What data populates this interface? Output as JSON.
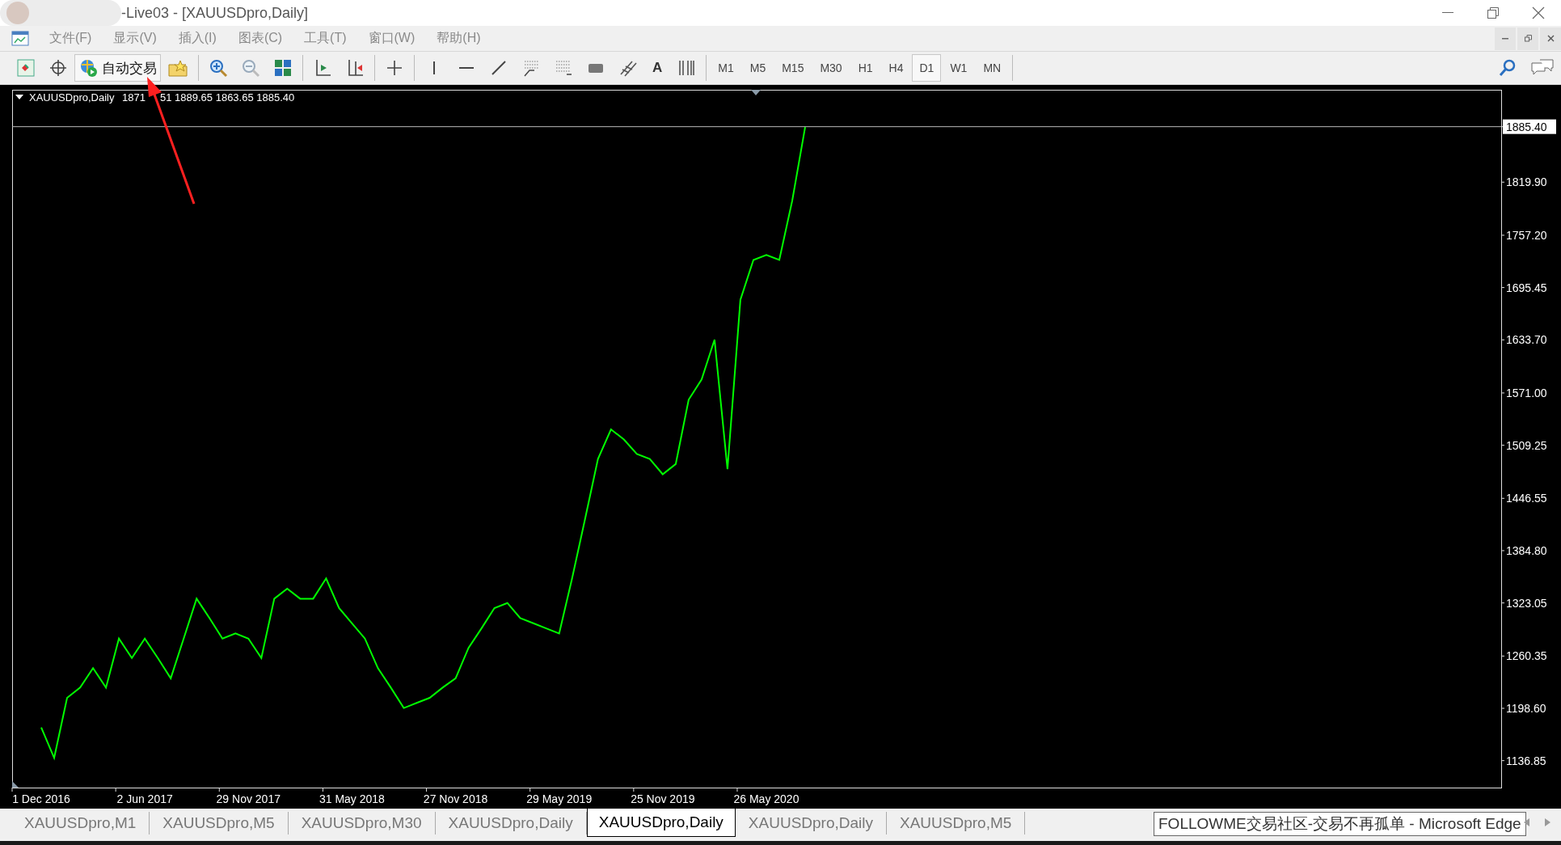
{
  "window": {
    "title": "-Live03 - [XAUUSDpro,Daily]"
  },
  "menu": [
    "文件(F)",
    "显示(V)",
    "插入(I)",
    "图表(C)",
    "工具(T)",
    "窗口(W)",
    "帮助(H)"
  ],
  "toolbar": {
    "auto_trading": "自动交易",
    "text_tool": "A",
    "timeframes": [
      {
        "label": "M1",
        "selected": false
      },
      {
        "label": "M5",
        "selected": false
      },
      {
        "label": "M15",
        "selected": false
      },
      {
        "label": "M30",
        "selected": false
      },
      {
        "label": "H1",
        "selected": false
      },
      {
        "label": "H4",
        "selected": false
      },
      {
        "label": "D1",
        "selected": true
      },
      {
        "label": "W1",
        "selected": false
      },
      {
        "label": "MN",
        "selected": false
      }
    ]
  },
  "chart": {
    "symbol": "XAUUSDpro,Daily",
    "ohlc_parts": [
      "1871",
      "51 1889.65 1863.65 1885.40"
    ],
    "chart_data": {
      "type": "line",
      "ylim": [
        1105,
        1929
      ],
      "categories": [
        "1 Dec 2016",
        null,
        null,
        null,
        null,
        null,
        null,
        null,
        "2 Jun 2017",
        null,
        null,
        null,
        null,
        null,
        null,
        null,
        "29 Nov 2017",
        null,
        null,
        null,
        null,
        null,
        null,
        null,
        "31 May 2018",
        null,
        null,
        null,
        null,
        null,
        null,
        null,
        "27 Nov 2018",
        null,
        null,
        null,
        null,
        null,
        null,
        null,
        "29 May 2019",
        null,
        null,
        null,
        null,
        null,
        null,
        null,
        "25 Nov 2019",
        null,
        null,
        null,
        null,
        null,
        null,
        null,
        "26 May 2020",
        null,
        null,
        null
      ],
      "yticks": [
        {
          "value": 1885.4,
          "label": "1885.40"
        },
        {
          "value": 1819.9,
          "label": "1819.90"
        },
        {
          "value": 1757.2,
          "label": "1757.20"
        },
        {
          "value": 1695.45,
          "label": "1695.45"
        },
        {
          "value": 1633.7,
          "label": "1633.70"
        },
        {
          "value": 1571,
          "label": "1571.00"
        },
        {
          "value": 1509.25,
          "label": "1509.25"
        },
        {
          "value": 1446.55,
          "label": "1446.55"
        },
        {
          "value": 1384.8,
          "label": "1384.80"
        },
        {
          "value": 1323.05,
          "label": "1323.05"
        },
        {
          "value": 1260.35,
          "label": "1260.35"
        },
        {
          "value": 1198.6,
          "label": "1198.60"
        },
        {
          "value": 1136.85,
          "label": "1136.85"
        }
      ],
      "series": [
        {
          "color": "#00ff00",
          "values": [
            1176,
            1140,
            1211,
            1223,
            1246,
            1223,
            1281,
            1258,
            1281,
            1258,
            1234,
            1281,
            1328,
            1305,
            1281,
            1287,
            1281,
            1258,
            1328,
            1340,
            1328,
            1328,
            1352,
            1317,
            1299,
            1281,
            1246,
            1223,
            1199,
            1205,
            1211,
            1223,
            1234,
            1270,
            1293,
            1317,
            1323,
            1305,
            1299,
            1293,
            1287,
            1352,
            1422,
            1493,
            1528,
            1516,
            1499,
            1493,
            1475,
            1487,
            1563,
            1587,
            1634,
            1481,
            1681,
            1728,
            1734,
            1728,
            1798,
            1885
          ]
        }
      ]
    }
  },
  "tabs": [
    {
      "label": "XAUUSDpro,M1",
      "selected": false
    },
    {
      "label": "XAUUSDpro,M5",
      "selected": false
    },
    {
      "label": "XAUUSDpro,M30",
      "selected": false
    },
    {
      "label": "XAUUSDpro,Daily",
      "selected": false
    },
    {
      "label": "XAUUSDpro,Daily",
      "selected": true
    },
    {
      "label": "XAUUSDpro,Daily",
      "selected": false
    },
    {
      "label": "XAUUSDpro,M5",
      "selected": false
    }
  ],
  "tooltip": "FOLLOWME交易社区-交易不再孤单 - Microsoft Edge"
}
